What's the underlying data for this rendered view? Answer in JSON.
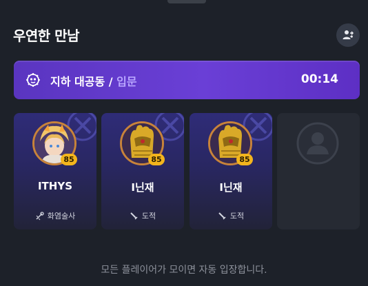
{
  "title": "우연한 만남",
  "banner": {
    "dungeon": "지하 대공동",
    "separator": "/",
    "difficulty": "입문",
    "timer": "00:14"
  },
  "party": [
    {
      "name": "ITHYS",
      "level": "85",
      "class": "화염술사",
      "portrait": "flame-mage-portrait"
    },
    {
      "name": "I닌재",
      "level": "85",
      "class": "도적",
      "portrait": "golden-gauntlet-portrait"
    },
    {
      "name": "I닌재",
      "level": "85",
      "class": "도적",
      "portrait": "golden-gauntlet-portrait"
    },
    {
      "empty": true
    }
  ],
  "footer": "모든 플레이어가 모이면 자동 입장합니다.",
  "colors": {
    "background": "#1d2129",
    "banner": "#6a3fd6",
    "difficulty": "#b9a6ff",
    "level_badge": "#f3b51d",
    "portrait_ring": "#c8833a"
  }
}
